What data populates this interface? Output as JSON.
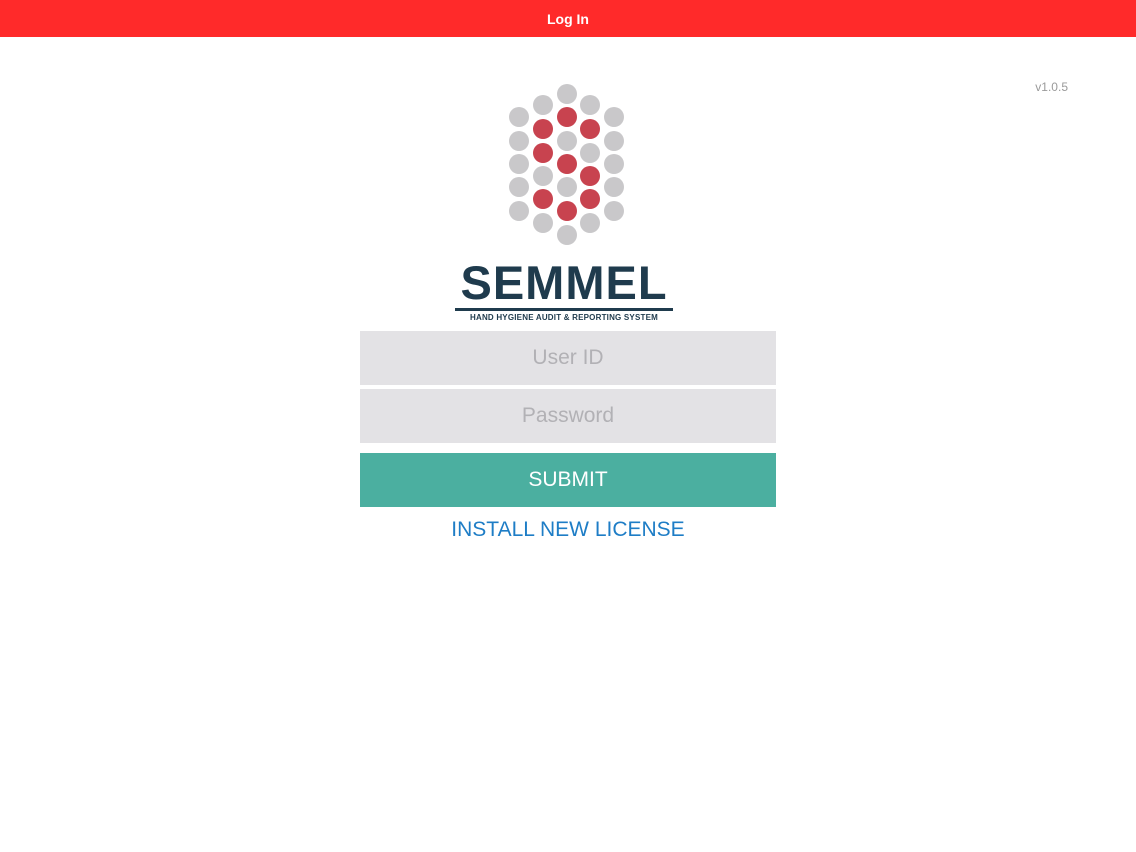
{
  "nav": {
    "title": "Log In",
    "background": "#ff2a2a"
  },
  "version": "v1.0.5",
  "logo": {
    "name": "SEMMEL",
    "tagline": "HAND HYGIENE AUDIT & REPORTING SYSTEM",
    "colors": {
      "accent": "#c8434f",
      "neutral": "#c9c8ca",
      "text": "#1f3b4d"
    }
  },
  "form": {
    "user_id_placeholder": "User ID",
    "user_id_value": "",
    "password_placeholder": "Password",
    "password_value": "",
    "submit_label": "SUBMIT",
    "submit_color": "#4bafa0"
  },
  "license_link": {
    "label": "INSTALL NEW LICENSE",
    "color": "#1e7dc6"
  }
}
